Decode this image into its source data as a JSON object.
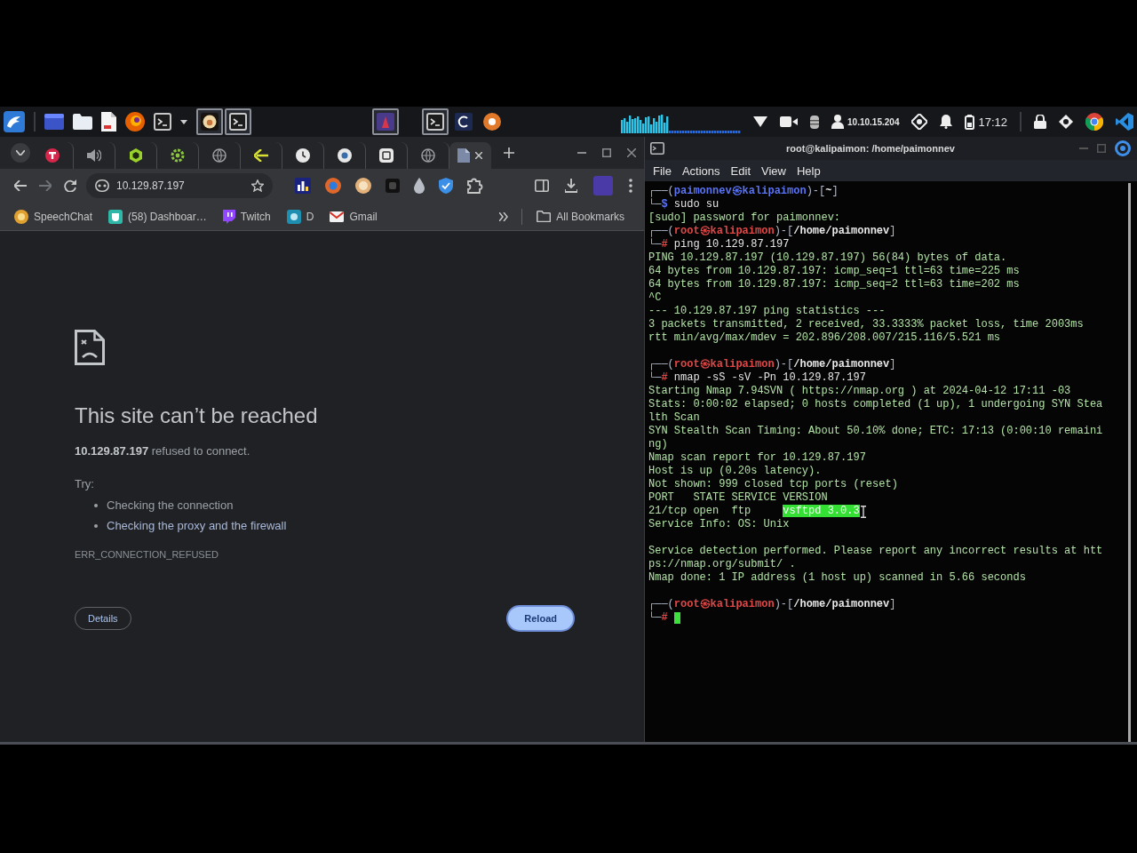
{
  "taskbar": {
    "tasks": [
      {
        "selected": true
      },
      {
        "selected": true
      },
      {
        "selected": true
      },
      {
        "selected": true
      },
      {
        "selected": false
      },
      {
        "selected": false
      }
    ],
    "ip_address": "10.10.15.204",
    "clock": "17:12"
  },
  "browser": {
    "tabs": [
      {
        "selected": false
      },
      {
        "selected": false
      },
      {
        "selected": false
      },
      {
        "selected": false
      },
      {
        "selected": false
      },
      {
        "selected": false
      },
      {
        "selected": false
      },
      {
        "selected": false
      },
      {
        "selected": false
      },
      {
        "selected": false
      },
      {
        "selected": true
      }
    ],
    "address": "10.129.87.197",
    "bookmarks": [
      {
        "label": "SpeechChat"
      },
      {
        "label": "(58) Dashboar…"
      },
      {
        "label": "Twitch"
      },
      {
        "label": "D"
      },
      {
        "label": "Gmail"
      }
    ],
    "all_bookmarks": "All Bookmarks",
    "error": {
      "title": "This site can’t be reached",
      "message": "**10.129.87.197** refused to connect.",
      "try_label": "Try:",
      "suggestions": [
        {
          "text": "Checking the connection",
          "kind": "text"
        },
        {
          "text": "Checking the proxy and the firewall",
          "kind": "link"
        }
      ],
      "code": "ERR_CONNECTION_REFUSED",
      "buttons": [
        {
          "label": "Details",
          "kind": "secondary"
        },
        {
          "label": "Reload",
          "kind": "primary"
        }
      ]
    }
  },
  "terminal": {
    "title": "root@kalipaimon: /home/paimonnev",
    "menu": [
      "File",
      "Actions",
      "Edit",
      "View",
      "Help"
    ],
    "lines": [
      {
        "kind": "text",
        "segments": [
          {
            "kind": "frame",
            "text": "┌──("
          },
          {
            "kind": "user",
            "text": "paimonnev㉿kalipaimon"
          },
          {
            "kind": "frame",
            "text": ")-["
          },
          {
            "kind": "path",
            "text": "~"
          },
          {
            "kind": "frame",
            "text": "]"
          }
        ]
      },
      {
        "kind": "text",
        "segments": [
          {
            "kind": "frame",
            "text": "└─"
          },
          {
            "kind": "user",
            "text": "$"
          },
          {
            "kind": "command",
            "text": " sudo su"
          }
        ]
      },
      {
        "kind": "text",
        "segments": [
          {
            "kind": "output",
            "text": "[sudo] password for paimonnev:"
          }
        ]
      },
      {
        "kind": "text",
        "segments": [
          {
            "kind": "frame",
            "text": "┌──("
          },
          {
            "kind": "root",
            "text": "root㉿kalipaimon"
          },
          {
            "kind": "frame",
            "text": ")-["
          },
          {
            "kind": "path",
            "text": "/home/paimonnev"
          },
          {
            "kind": "frame",
            "text": "]"
          }
        ]
      },
      {
        "kind": "text",
        "segments": [
          {
            "kind": "frame",
            "text": "└─"
          },
          {
            "kind": "root",
            "text": "#"
          },
          {
            "kind": "command",
            "text": " ping 10.129.87.197"
          }
        ]
      },
      {
        "kind": "text",
        "segments": [
          {
            "kind": "output",
            "text": "PING 10.129.87.197 (10.129.87.197) 56(84) bytes of data."
          }
        ]
      },
      {
        "kind": "text",
        "segments": [
          {
            "kind": "output",
            "text": "64 bytes from 10.129.87.197: icmp_seq=1 ttl=63 time=225 ms"
          }
        ]
      },
      {
        "kind": "text",
        "segments": [
          {
            "kind": "output",
            "text": "64 bytes from 10.129.87.197: icmp_seq=2 ttl=63 time=202 ms"
          }
        ]
      },
      {
        "kind": "text",
        "segments": [
          {
            "kind": "output",
            "text": "^C"
          }
        ]
      },
      {
        "kind": "text",
        "segments": [
          {
            "kind": "output",
            "text": "--- 10.129.87.197 ping statistics ---"
          }
        ]
      },
      {
        "kind": "text",
        "segments": [
          {
            "kind": "output",
            "text": "3 packets transmitted, 2 received, 33.3333% packet loss, time 2003ms"
          }
        ]
      },
      {
        "kind": "text",
        "segments": [
          {
            "kind": "output",
            "text": "rtt min/avg/max/mdev = 202.896/208.007/215.116/5.521 ms"
          }
        ]
      },
      {
        "kind": "blank"
      },
      {
        "kind": "text",
        "segments": [
          {
            "kind": "frame",
            "text": "┌──("
          },
          {
            "kind": "root",
            "text": "root㉿kalipaimon"
          },
          {
            "kind": "frame",
            "text": ")-["
          },
          {
            "kind": "path",
            "text": "/home/paimonnev"
          },
          {
            "kind": "frame",
            "text": "]"
          }
        ]
      },
      {
        "kind": "text",
        "segments": [
          {
            "kind": "frame",
            "text": "└─"
          },
          {
            "kind": "root",
            "text": "#"
          },
          {
            "kind": "command",
            "text": " nmap -sS -sV -Pn 10.129.87.197"
          }
        ]
      },
      {
        "kind": "text",
        "segments": [
          {
            "kind": "output",
            "text": "Starting Nmap 7.94SVN ( https://nmap.org ) at 2024-04-12 17:11 -03"
          }
        ]
      },
      {
        "kind": "text",
        "segments": [
          {
            "kind": "output",
            "text": "Stats: 0:00:02 elapsed; 0 hosts completed (1 up), 1 undergoing SYN Stea"
          }
        ]
      },
      {
        "kind": "text",
        "segments": [
          {
            "kind": "output",
            "text": "lth Scan"
          }
        ]
      },
      {
        "kind": "text",
        "segments": [
          {
            "kind": "output",
            "text": "SYN Stealth Scan Timing: About 50.10% done; ETC: 17:13 (0:00:10 remaini"
          }
        ]
      },
      {
        "kind": "text",
        "segments": [
          {
            "kind": "output",
            "text": "ng)"
          }
        ]
      },
      {
        "kind": "text",
        "segments": [
          {
            "kind": "output",
            "text": "Nmap scan report for 10.129.87.197"
          }
        ]
      },
      {
        "kind": "text",
        "segments": [
          {
            "kind": "output",
            "text": "Host is up (0.20s latency)."
          }
        ]
      },
      {
        "kind": "text",
        "segments": [
          {
            "kind": "output",
            "text": "Not shown: 999 closed tcp ports (reset)"
          }
        ]
      },
      {
        "kind": "text",
        "segments": [
          {
            "kind": "output",
            "text": "PORT   STATE SERVICE VERSION"
          }
        ]
      },
      {
        "kind": "text",
        "segments": [
          {
            "kind": "output",
            "text": "21/tcp open  ftp     "
          },
          {
            "kind": "selected",
            "text": "vsftpd 3.0.3"
          },
          {
            "kind": "pointer"
          }
        ]
      },
      {
        "kind": "text",
        "segments": [
          {
            "kind": "output",
            "text": "Service Info: OS: Unix"
          }
        ]
      },
      {
        "kind": "blank"
      },
      {
        "kind": "text",
        "segments": [
          {
            "kind": "output",
            "text": "Service detection performed. Please report any incorrect results at htt"
          }
        ]
      },
      {
        "kind": "text",
        "segments": [
          {
            "kind": "output",
            "text": "ps://nmap.org/submit/ ."
          }
        ]
      },
      {
        "kind": "text",
        "segments": [
          {
            "kind": "output",
            "text": "Nmap done: 1 IP address (1 host up) scanned in 5.66 seconds"
          }
        ]
      },
      {
        "kind": "blank"
      },
      {
        "kind": "text",
        "segments": [
          {
            "kind": "frame",
            "text": "┌──("
          },
          {
            "kind": "root",
            "text": "root㉿kalipaimon"
          },
          {
            "kind": "frame",
            "text": ")-["
          },
          {
            "kind": "path",
            "text": "/home/paimonnev"
          },
          {
            "kind": "frame",
            "text": "]"
          }
        ]
      },
      {
        "kind": "text",
        "segments": [
          {
            "kind": "frame",
            "text": "└─"
          },
          {
            "kind": "root",
            "text": "#"
          },
          {
            "kind": "cursor"
          }
        ]
      }
    ]
  }
}
